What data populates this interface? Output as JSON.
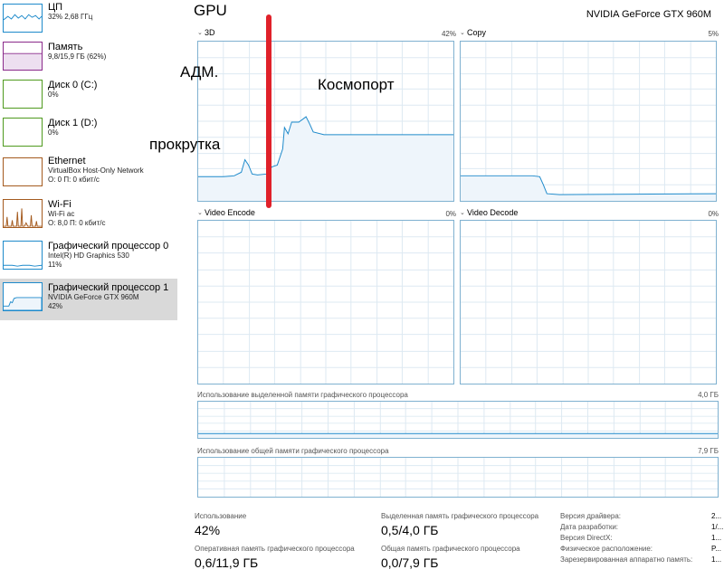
{
  "sidebar": {
    "items": [
      {
        "name": "ЦП",
        "sub1": "32% 2,68 ГГц",
        "sub2": "",
        "sub3": "",
        "color": "#1e8acb"
      },
      {
        "name": "Память",
        "sub1": "9,8/15,9 ГБ (62%)",
        "sub2": "",
        "sub3": "",
        "color": "#8b2a8b"
      },
      {
        "name": "Диск 0 (C:)",
        "sub1": "0%",
        "sub2": "",
        "sub3": "",
        "color": "#4f9a1e"
      },
      {
        "name": "Диск 1 (D:)",
        "sub1": "0%",
        "sub2": "",
        "sub3": "",
        "color": "#4f9a1e"
      },
      {
        "name": "Ethernet",
        "sub1": "VirtualBox Host-Only Network",
        "sub2": "О: 0 П: 0 кбит/с",
        "sub3": "",
        "color": "#a45a1e"
      },
      {
        "name": "Wi-Fi",
        "sub1": "Wi-Fi ac",
        "sub2": "О: 8,0 П: 0 кбит/с",
        "sub3": "",
        "color": "#a45a1e"
      },
      {
        "name": "Графический процессор 0",
        "sub1": "Intel(R) HD Graphics 530",
        "sub2": "11%",
        "sub3": "",
        "color": "#1e8acb"
      },
      {
        "name": "Графический процессор 1",
        "sub1": "NVIDIA GeForce GTX 960M",
        "sub2": "42%",
        "sub3": "",
        "color": "#1e8acb"
      }
    ]
  },
  "header": {
    "title": "GPU",
    "model": "NVIDIA GeForce GTX 960M"
  },
  "panels": {
    "d3": {
      "label": "3D",
      "max": "42%"
    },
    "copy": {
      "label": "Copy",
      "max": "5%"
    },
    "video_encode": {
      "label": "Video Encode",
      "max": "0%"
    },
    "video_decode": {
      "label": "Video Decode",
      "max": "0%"
    }
  },
  "memory": {
    "dedicated": {
      "label": "Использование выделенной памяти графического процессора",
      "max": "4,0 ГБ"
    },
    "shared": {
      "label": "Использование общей памяти графического процессора",
      "max": "7,9 ГБ"
    }
  },
  "annotations": {
    "adm": "АДМ.",
    "cosmoport": "Космопорт",
    "scroll": "прокрутка"
  },
  "stats": {
    "usage_label": "Использование",
    "usage_value": "42%",
    "dedicated_label": "Выделенная память графического процессора",
    "dedicated_value": "0,5/4,0 ГБ",
    "gpu_mem_label": "Оперативная память графического процессора",
    "gpu_mem_value": "0,6/11,9 ГБ",
    "shared_label": "Общая память графического процессора",
    "shared_value": "0,0/7,9 ГБ"
  },
  "info": [
    {
      "label": "Версия драйвера:",
      "value": "2..."
    },
    {
      "label": "Дата разработки:",
      "value": "1/..."
    },
    {
      "label": "Версия DirectX:",
      "value": "1..."
    },
    {
      "label": "Физическое расположение:",
      "value": "P..."
    },
    {
      "label": "Зарезервированная аппаратно память:",
      "value": "1..."
    }
  ],
  "colors": {
    "accent": "#1e8acb",
    "graph_border": "#7fb1d0",
    "graph_fill": "#eef5fb",
    "annotation_bar": "#e0212a",
    "selected_bg": "#d9d9d9"
  }
}
